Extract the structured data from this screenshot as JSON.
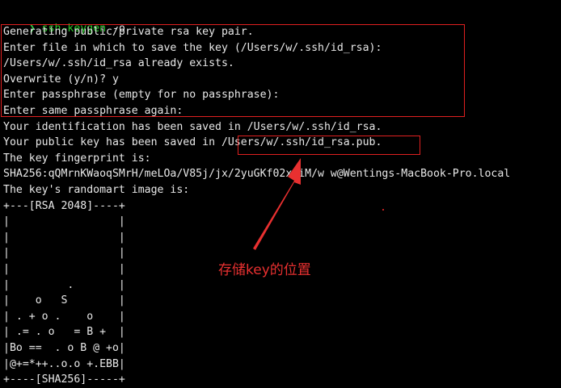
{
  "terminal": {
    "prompt_symbol": "❯",
    "command": "ssh-keygen",
    "command_flag": " -o",
    "output_lines": [
      "Generating public/private rsa key pair.",
      "Enter file in which to save the key (/Users/w/.ssh/id_rsa):",
      "/Users/w/.ssh/id_rsa already exists.",
      "Overwrite (y/n)? y",
      "Enter passphrase (empty for no passphrase):",
      "Enter same passphrase again:",
      "Your identification has been saved in /Users/w/.ssh/id_rsa.",
      "Your public key has been saved in /Users/w/.ssh/id_rsa.pub.",
      "The key fingerprint is:",
      "SHA256:qQMrnKWaoqSMrH/meLOa/V85j/jx/2yuGKf02xpiM/w w@Wentings-MacBook-Pro.local",
      "The key's randomart image is:",
      "+---[RSA 2048]----+",
      "|                 |",
      "|                 |",
      "|                 |",
      "|                 |",
      "|         .       |",
      "|    o   S        |",
      "| . + o .    o    |",
      "| .= . o   = B +  |",
      "|Bo ==  . o B @ +o|",
      "|@+=*++..o.o +.EBB|",
      "+----[SHA256]-----+"
    ]
  },
  "annotation": {
    "label": "存储key的位置",
    "color": "#e83030"
  },
  "colors": {
    "background": "#000000",
    "text": "#e8e8e8",
    "command": "#28c828",
    "highlight": "#e02020"
  }
}
